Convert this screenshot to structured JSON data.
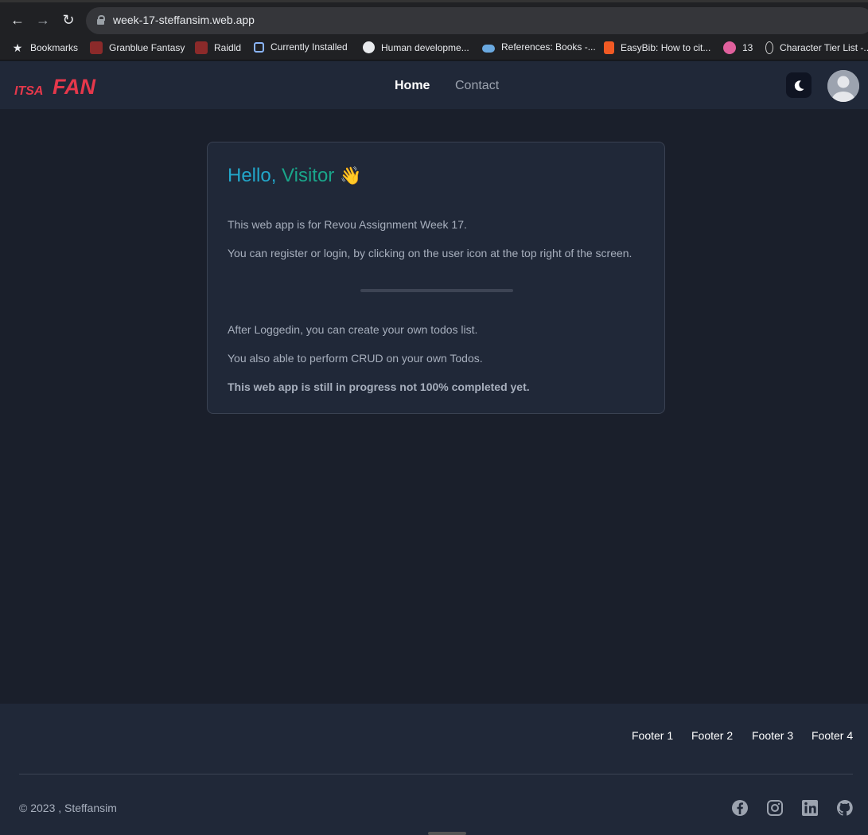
{
  "browser": {
    "url": "week-17-steffansim.web.app",
    "bookmarks": [
      {
        "label": "Bookmarks",
        "icon": "star-icon"
      },
      {
        "label": "Granblue Fantasy",
        "icon": "granblue-icon"
      },
      {
        "label": "Raidld",
        "icon": "raid-icon"
      },
      {
        "label": "Currently Installed",
        "icon": "cube-icon"
      },
      {
        "label": "Human developme...",
        "icon": "globe-icon"
      },
      {
        "label": "References: Books -...",
        "icon": "cloud-icon"
      },
      {
        "label": "EasyBib: How to cit...",
        "icon": "easybib-icon"
      },
      {
        "label": "13",
        "icon": "pink-circle-icon"
      },
      {
        "label": "Character Tier List -...",
        "icon": "tier-icon"
      }
    ]
  },
  "header": {
    "logo_text_small": "ITSA",
    "logo_text_large": "FAN",
    "nav": {
      "home": "Home",
      "contact": "Contact"
    }
  },
  "card": {
    "hello": "Hello,",
    "visitor": "Visitor",
    "wave": "👋",
    "line1": "This web app is for Revou Assignment Week 17.",
    "line2": "You can register or login, by clicking on the user icon at the top right of the screen.",
    "line3": "After Loggedin, you can create your own todos list.",
    "line4": "You also able to perform CRUD on your own Todos.",
    "line5": "This web app is still in progress not 100% completed yet."
  },
  "footer": {
    "links": [
      "Footer 1",
      "Footer 2",
      "Footer 3",
      "Footer 4"
    ],
    "copyright": "© 2023 , Steffansim"
  },
  "colors": {
    "page_bg": "#1a1f2b",
    "panel_bg": "#202838",
    "logo": "#e5384b",
    "hello": "#22a6c9",
    "visitor": "#1aa58a"
  }
}
